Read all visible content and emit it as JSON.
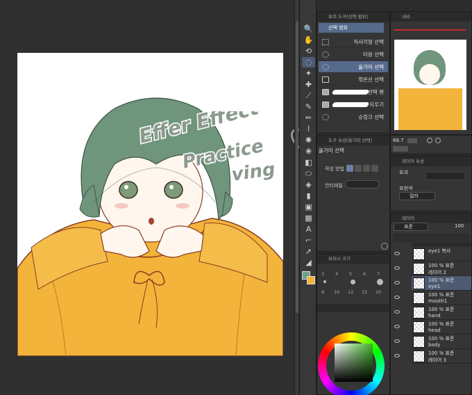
{
  "subtool_panel": {
    "title": "보조 도구[선택 범위]",
    "group_label": "선택 범위",
    "items": [
      {
        "label": "직사각형 선택"
      },
      {
        "label": "타원 선택"
      },
      {
        "label": "올가미 선택"
      },
      {
        "label": "꺾은선 선택"
      },
      {
        "label": "선택 펜"
      },
      {
        "label": "선택 지우기"
      },
      {
        "label": "슈링크 선택"
      }
    ]
  },
  "navigator": {
    "tab": "내비",
    "zoom": "66.7"
  },
  "tool_property": {
    "title": "도구 속성[올가미 선택]",
    "tool_name": "올가미 선택",
    "mode_label": "작성 방법",
    "antialias_label": "안티에일"
  },
  "brush_size": {
    "title": "브러시 크기",
    "sizes": [
      "3",
      "4",
      "5",
      "6",
      "7",
      "8",
      "10",
      "12",
      "15",
      "20"
    ]
  },
  "layer_property": {
    "title": "레이어 속성",
    "effect_label": "효과",
    "expression_label": "표현색",
    "expression_value": "컬러"
  },
  "layers": {
    "tab": "레이어",
    "blend": "표준",
    "opacity": "100",
    "rows": [
      {
        "line1": "eye1 복사",
        "line2": ""
      },
      {
        "line1": "100 % 표준",
        "line2": "레이어 2"
      },
      {
        "line1": "100 % 표준",
        "line2": "eye1"
      },
      {
        "line1": "100 % 표준",
        "line2": "mouth1"
      },
      {
        "line1": "100 % 표준",
        "line2": "hand"
      },
      {
        "line1": "100 % 표준",
        "line2": "head"
      },
      {
        "line1": "100 % 표준",
        "line2": "body"
      },
      {
        "line1": "100 % 표준",
        "line2": "레이어 3"
      }
    ]
  },
  "overlay_text": {
    "line1": "Effer Effect",
    "line2": "Practice",
    "line3": "ving"
  },
  "colors": {
    "accent": "#566a8c",
    "hair": "#6f957c",
    "sweater": "#f2b43a",
    "handwriting": "#8c9a8e"
  }
}
